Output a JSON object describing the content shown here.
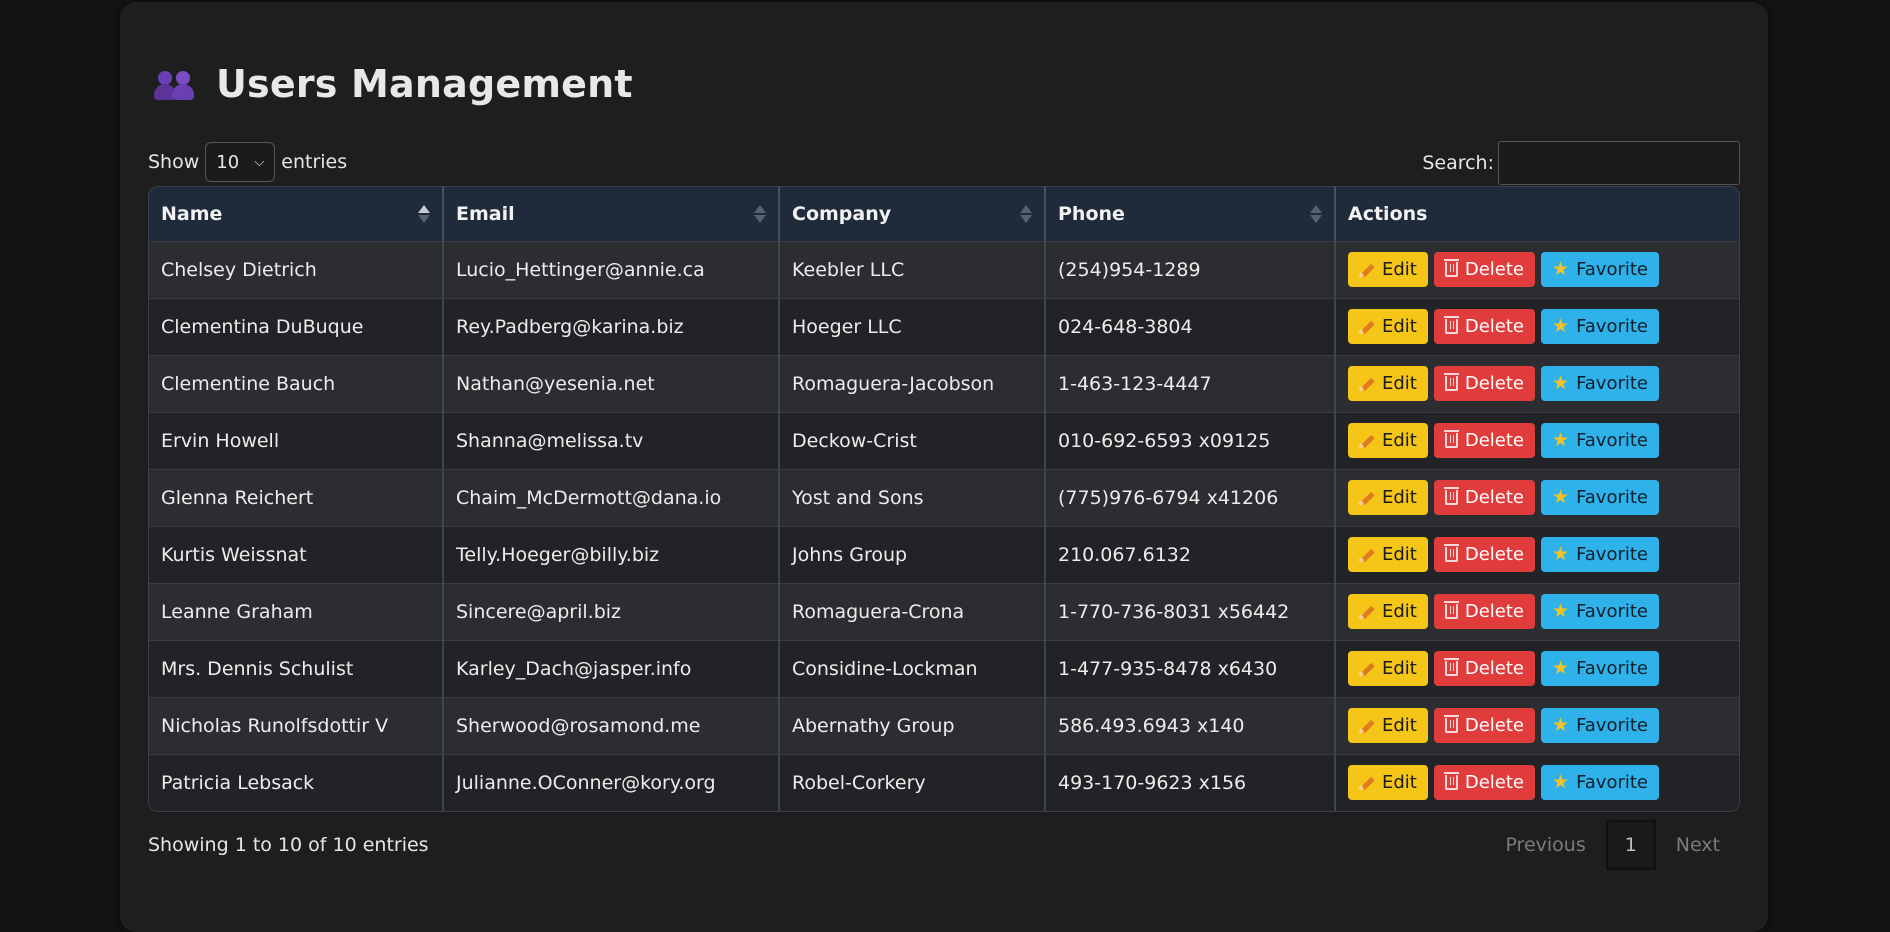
{
  "header": {
    "title": "Users Management",
    "icon": "users-icon"
  },
  "controls": {
    "show_label": "Show",
    "entries_label": "entries",
    "length_value": "10",
    "search_label": "Search:",
    "search_value": ""
  },
  "table": {
    "columns": [
      "Name",
      "Email",
      "Company",
      "Phone",
      "Actions"
    ],
    "sort_column": "Name",
    "action_labels": {
      "edit": "Edit",
      "delete": "Delete",
      "favorite": "Favorite"
    },
    "rows": [
      {
        "name": "Chelsey Dietrich",
        "email": "Lucio_Hettinger@annie.ca",
        "company": "Keebler LLC",
        "phone": "(254)954-1289"
      },
      {
        "name": "Clementina DuBuque",
        "email": "Rey.Padberg@karina.biz",
        "company": "Hoeger LLC",
        "phone": "024-648-3804"
      },
      {
        "name": "Clementine Bauch",
        "email": "Nathan@yesenia.net",
        "company": "Romaguera-Jacobson",
        "phone": "1-463-123-4447"
      },
      {
        "name": "Ervin Howell",
        "email": "Shanna@melissa.tv",
        "company": "Deckow-Crist",
        "phone": "010-692-6593 x09125"
      },
      {
        "name": "Glenna Reichert",
        "email": "Chaim_McDermott@dana.io",
        "company": "Yost and Sons",
        "phone": "(775)976-6794 x41206"
      },
      {
        "name": "Kurtis Weissnat",
        "email": "Telly.Hoeger@billy.biz",
        "company": "Johns Group",
        "phone": "210.067.6132"
      },
      {
        "name": "Leanne Graham",
        "email": "Sincere@april.biz",
        "company": "Romaguera-Crona",
        "phone": "1-770-736-8031 x56442"
      },
      {
        "name": "Mrs. Dennis Schulist",
        "email": "Karley_Dach@jasper.info",
        "company": "Considine-Lockman",
        "phone": "1-477-935-8478 x6430"
      },
      {
        "name": "Nicholas Runolfsdottir V",
        "email": "Sherwood@rosamond.me",
        "company": "Abernathy Group",
        "phone": "586.493.6943 x140"
      },
      {
        "name": "Patricia Lebsack",
        "email": "Julianne.OConner@kory.org",
        "company": "Robel-Corkery",
        "phone": "493-170-9623 x156"
      }
    ]
  },
  "footer": {
    "info": "Showing 1 to 10 of 10 entries",
    "previous": "Previous",
    "current_page": "1",
    "next": "Next"
  },
  "colors": {
    "edit": "#f5c518",
    "delete": "#e03c3c",
    "favorite": "#2fb2ea",
    "header_bg": "#1f2a3b"
  }
}
